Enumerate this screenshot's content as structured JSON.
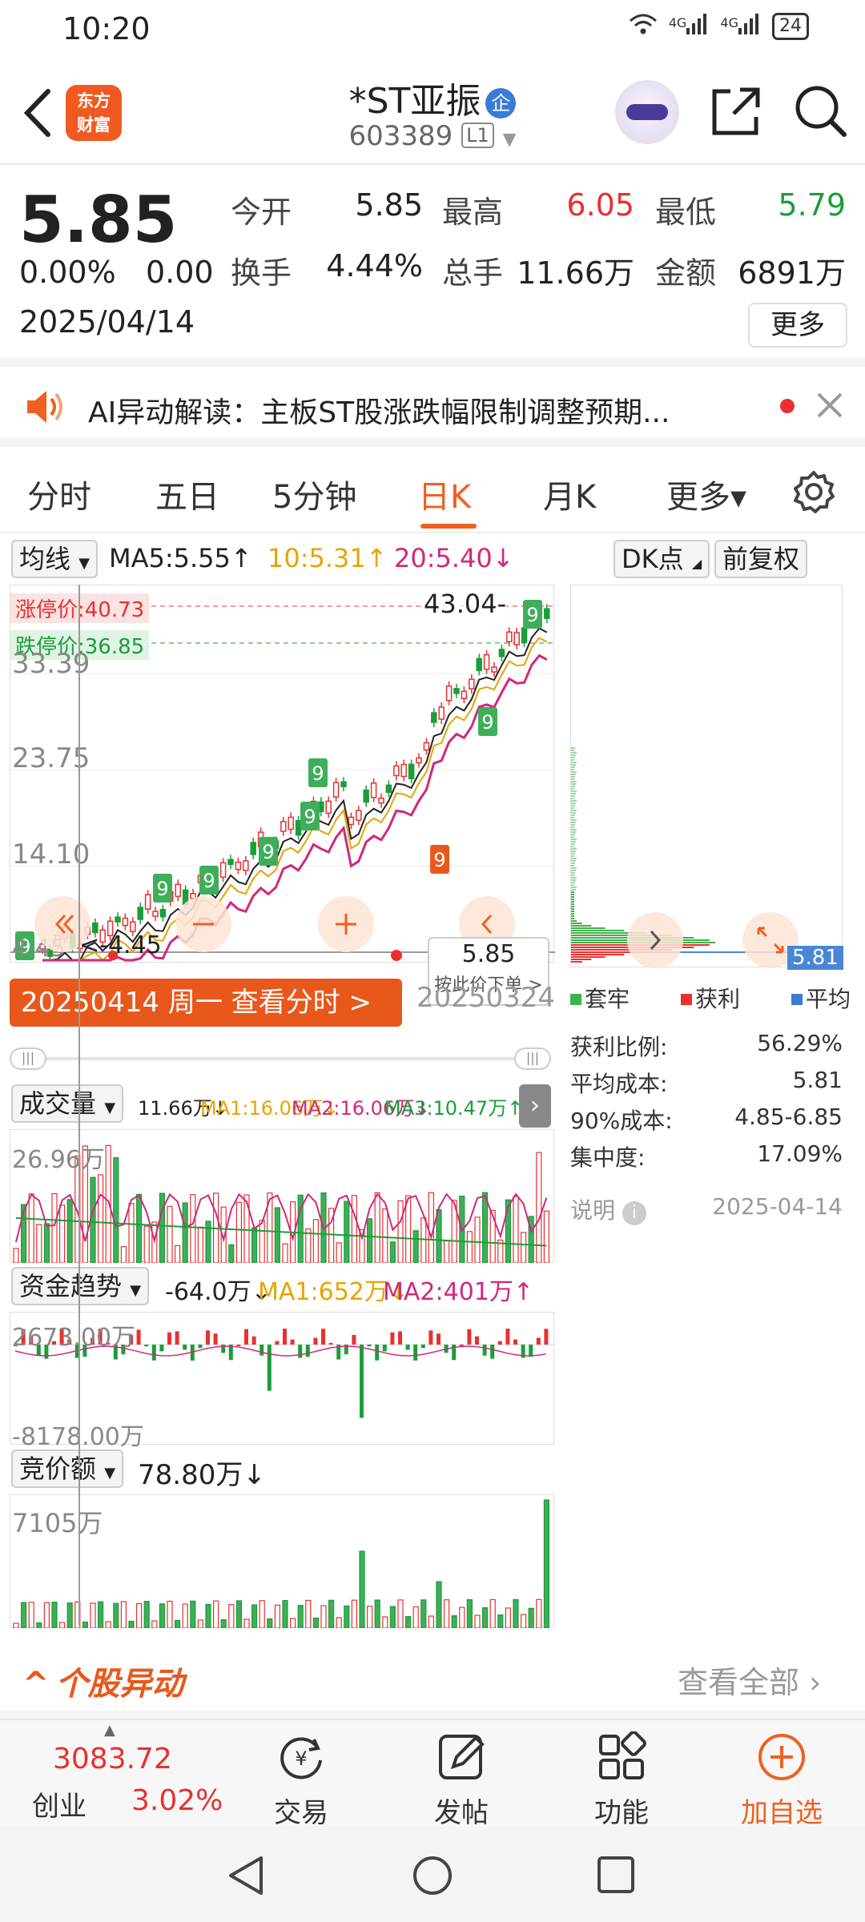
{
  "status": {
    "time": "10:20",
    "network": "4G",
    "network2": "4G",
    "battery": "24"
  },
  "header": {
    "logo_line1": "东方",
    "logo_line2": "财富",
    "stock_name": "*ST亚振",
    "stock_tag": "企",
    "stock_code": "603389",
    "level": "L1"
  },
  "quote": {
    "price": "5.85",
    "change_pct": "0.00%",
    "change": "0.00",
    "date": "2025/04/14",
    "open_label": "今开",
    "open": "5.85",
    "high_label": "最高",
    "high": "6.05",
    "low_label": "最低",
    "low": "5.79",
    "turnover_label": "换手",
    "turnover": "4.44%",
    "volume_label": "总手",
    "volume": "11.66万",
    "amount_label": "金额",
    "amount": "6891万",
    "more_button": "更多"
  },
  "ai_banner": {
    "text": "AI异动解读：主板ST股涨跌幅限制调整预期..."
  },
  "tabs": [
    {
      "label": "分时"
    },
    {
      "label": "五日"
    },
    {
      "label": "5分钟"
    },
    {
      "label": "日K"
    },
    {
      "label": "月K"
    },
    {
      "label": "更多▾"
    }
  ],
  "indicator_bar": {
    "ma_select": "均线",
    "ma5": "MA5:5.55↑",
    "ma10": "10:5.31↑",
    "ma20": "20:5.40↓",
    "dk_button": "DK点",
    "fq_button": "前复权"
  },
  "kchart": {
    "limit_up": "涨停价:40.73",
    "limit_down": "跌停价:36.85",
    "top_value": "43.04",
    "top_label_partial": "43.04",
    "y_ticks": [
      "33.39",
      "23.75",
      "14.10",
      "4.45"
    ],
    "low_marker": "4.45",
    "price_tag": "5.85",
    "price_tag_hint": "按此价下单 >",
    "date_bar": "20250414 周一 查看分时 >",
    "date_bar_ghost": "20250324",
    "markers": [
      "9",
      "9",
      "9",
      "9",
      "9",
      "9",
      "9",
      "9",
      "9"
    ]
  },
  "chips": {
    "current": "5.81",
    "legend": [
      "套牢",
      "获利",
      "平均"
    ],
    "rows": [
      {
        "label": "获利比例:",
        "value": "56.29%"
      },
      {
        "label": "平均成本:",
        "value": "5.81"
      },
      {
        "label": "90%成本:",
        "value": "4.85-6.85"
      },
      {
        "label": "集中度:",
        "value": "17.09%"
      }
    ],
    "note_label": "说明",
    "note_date": "2025-04-14"
  },
  "volume_panel": {
    "select": "成交量",
    "vol": "11.66万↓",
    "ma1": "MA1:16.06万↓",
    "ma2": "MA2:16.06万↓",
    "ma3": "MA3:10.47万↑",
    "max": "26.96万"
  },
  "fund_panel": {
    "select": "资金趋势",
    "value": "-64.0万↓",
    "ma1": "MA1:652万↓",
    "ma2": "MA2:401万↑",
    "max": "2673.00万",
    "min": "-8178.00万"
  },
  "auction_panel": {
    "select": "竞价额",
    "value": "78.80万↓",
    "max": "7105万"
  },
  "events": {
    "title": "个股异动",
    "link": "查看全部"
  },
  "bottom_nav": {
    "index_value": "3083.72",
    "index_name": "创业",
    "index_pct": "3.02%",
    "trade": "交易",
    "post": "发帖",
    "functions": "功能",
    "watchlist": "加自选"
  },
  "colors": {
    "up": "#e93030",
    "down": "#1a9e3a",
    "accent": "#f06020"
  }
}
